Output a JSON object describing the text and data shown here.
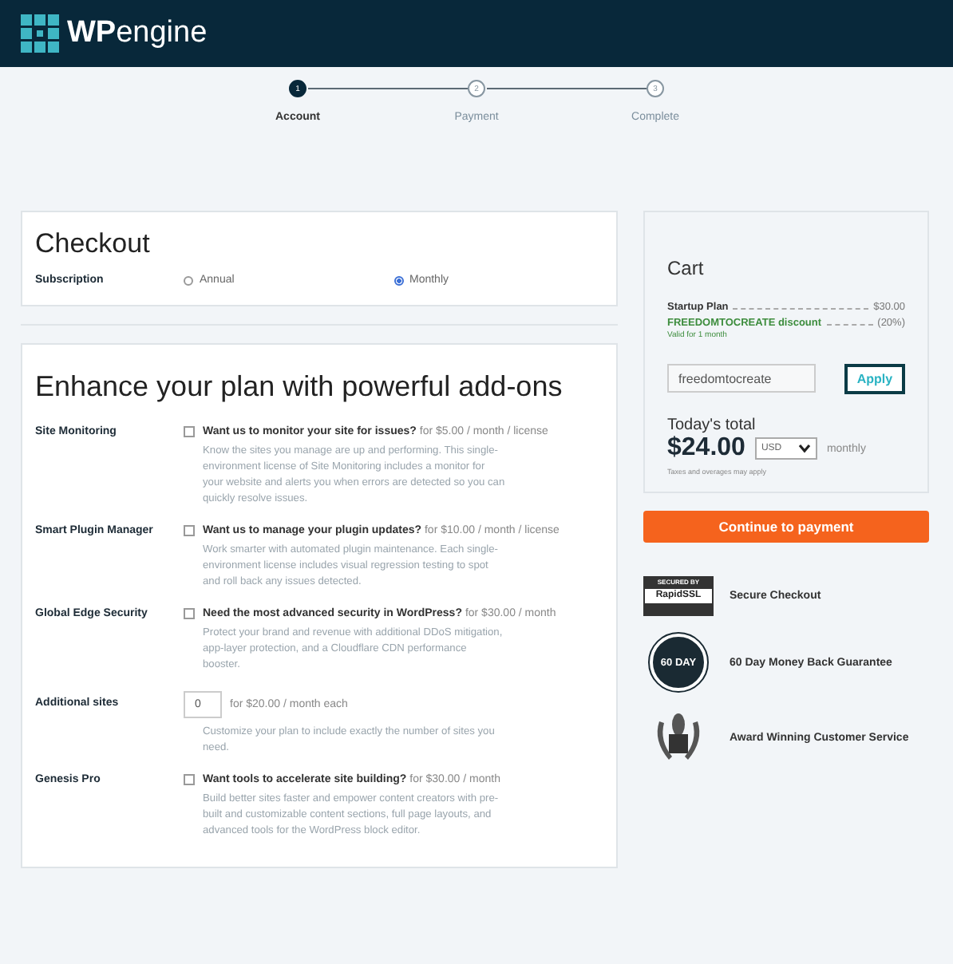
{
  "header": {
    "logo_text_bold": "WP",
    "logo_text": "engine"
  },
  "steps": [
    {
      "number": "1",
      "label": "Account",
      "selected": true
    },
    {
      "number": "2",
      "label": "Payment",
      "selected": false
    },
    {
      "number": "3",
      "label": "Complete",
      "selected": false
    }
  ],
  "checkout": {
    "title": "Checkout",
    "subscription_label": "Subscription",
    "options": [
      {
        "label": "Annual",
        "selected": false
      },
      {
        "label": "Monthly",
        "selected": true
      }
    ]
  },
  "addons": {
    "title": "Enhance your plan with powerful add-ons",
    "items": [
      {
        "kind": "checkbox",
        "name": "Site Monitoring",
        "question": "Want us to monitor your site for issues?",
        "price": "for $5.00 / month / license",
        "checked": false,
        "description": "Know the sites you manage are up and performing. This single-environment license of Site Monitoring includes a monitor for your website and alerts you when errors are detected so you can quickly resolve issues."
      },
      {
        "kind": "checkbox",
        "name": "Smart Plugin Manager",
        "question": "Want us to manage your plugin updates?",
        "price": "for $10.00 / month / license",
        "checked": false,
        "description": "Work smarter with automated plugin maintenance. Each single-environment license includes visual regression testing to spot and roll back any issues detected."
      },
      {
        "kind": "checkbox",
        "name": "Global Edge Security",
        "question": "Need the most advanced security in WordPress?",
        "price": "for $30.00 / month",
        "checked": false,
        "description": "Protect your brand and revenue with additional DDoS mitigation, app-layer protection, and a Cloudflare CDN performance booster."
      },
      {
        "kind": "quantity",
        "name": "Additional sites",
        "value": "0",
        "price": "for $20.00 / month each",
        "description": "Customize your plan to include exactly the number of sites you need."
      },
      {
        "kind": "checkbox",
        "name": "Genesis Pro",
        "question": "Want tools to accelerate site building?",
        "price": "for $30.00 / month",
        "checked": false,
        "description": "Build better sites faster and empower content creators with pre-built and customizable content sections, full page layouts, and advanced tools for the WordPress block editor."
      }
    ]
  },
  "cart": {
    "title": "Cart",
    "lines": [
      {
        "kind": "plan",
        "label": "Startup Plan",
        "amount": "$30.00"
      },
      {
        "kind": "discount",
        "label": "FREEDOMTOCREATE discount",
        "amount": "(20%)",
        "note": "Valid for 1 month"
      }
    ],
    "coupon_value": "freedomtocreate",
    "apply": "Apply",
    "total_label": "Today's total",
    "total": "$24.00",
    "currency": "USD",
    "period": "monthly",
    "taxes_note": "Taxes and overages may apply"
  },
  "continue_button": "Continue to payment",
  "assurances": [
    {
      "kind": "ssl",
      "badge_top": "SECURED BY",
      "badge_main": "RapidSSL",
      "label": "Secure Checkout"
    },
    {
      "kind": "seal",
      "badge_main": "60 DAY",
      "label": "60 Day Money Back Guarantee"
    },
    {
      "kind": "award",
      "label": "Award Winning Customer Service"
    }
  ]
}
